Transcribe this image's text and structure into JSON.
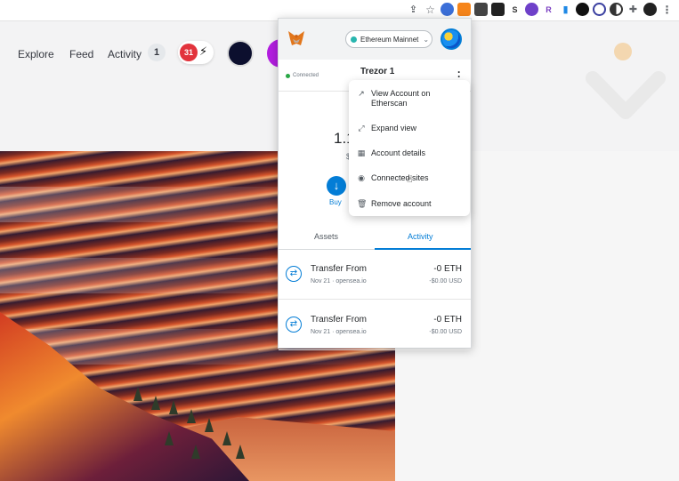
{
  "toolbar": {
    "icons": [
      "share-icon",
      "star-icon",
      "ext-blue-icon",
      "metamask-ext-icon",
      "ext-badge-icon",
      "ext-dark-icon",
      "s-icon",
      "github-icon",
      "r-icon",
      "bookmark-icon",
      "circle-ext-icon",
      "globe-ext-icon",
      "contrast-ext-icon",
      "puzzle-icon",
      "profile-avatar",
      "more-vert-icon"
    ],
    "s_label": "S",
    "r_label": "R"
  },
  "site": {
    "nav": {
      "explore": "Explore",
      "feed": "Feed",
      "activity": "Activity",
      "activity_count": "1"
    },
    "notification_count": "31"
  },
  "metamask": {
    "network": "Ethereum Mainnet",
    "connected_label": "Connected",
    "account_name": "Trezor 1",
    "balance": "1.1",
    "fiat": "$",
    "buy_label": "Buy",
    "tabs": {
      "assets": "Assets",
      "activity": "Activity"
    },
    "transactions": [
      {
        "title": "Transfer From",
        "subtitle": "Nov 21 · opensea.io",
        "amount": "-0 ETH",
        "fiat": "-$0.00 USD"
      },
      {
        "title": "Transfer From",
        "subtitle": "Nov 21 · opensea.io",
        "amount": "-0 ETH",
        "fiat": "-$0.00 USD"
      }
    ],
    "menu": [
      {
        "label": "View Account on Etherscan",
        "icon": "external-link-icon"
      },
      {
        "label": "Expand view",
        "icon": "expand-icon"
      },
      {
        "label": "Account details",
        "icon": "grid-icon"
      },
      {
        "label": "Connected sites",
        "icon": "connected-sites-icon"
      },
      {
        "label": "Remove account",
        "icon": "trash-icon"
      }
    ]
  },
  "colors": {
    "accent": "#037dd6",
    "network_dot": "#29b6af",
    "notification_red": "#e2333c"
  }
}
